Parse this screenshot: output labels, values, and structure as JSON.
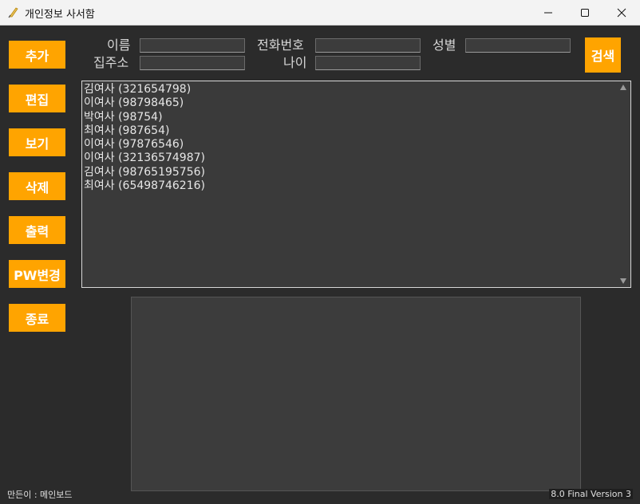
{
  "window": {
    "title": "개인정보 사서함"
  },
  "sidebar": {
    "buttons": [
      {
        "label": "추가"
      },
      {
        "label": "편집"
      },
      {
        "label": "보기"
      },
      {
        "label": "삭제"
      },
      {
        "label": "출력"
      },
      {
        "label": "PW변경"
      },
      {
        "label": "종료"
      }
    ]
  },
  "search_form": {
    "name_label": "이름",
    "phone_label": "전화번호",
    "gender_label": "성별",
    "address_label": "집주소",
    "age_label": "나이",
    "name_value": "",
    "phone_value": "",
    "gender_value": "",
    "address_value": "",
    "age_value": "",
    "search_button": "검색"
  },
  "records": [
    "김여사 (321654798)",
    "이여사 (98798465)",
    "박여사 (98754)",
    "최여사 (987654)",
    "이여사 (97876546)",
    "이여사 (32136574987)",
    "김여사 (98765195756)",
    "최여사 (65498746216)"
  ],
  "footer": {
    "credit": "만든이 : 메인보드",
    "version": "8.0 Final Version 3"
  },
  "colors": {
    "accent": "#ffa400",
    "background": "#2b2b2b",
    "field": "#3c3c3c"
  },
  "icons": {
    "app": "feather-pen-icon",
    "minimize": "minimize-icon",
    "maximize": "maximize-icon",
    "close": "close-icon"
  }
}
